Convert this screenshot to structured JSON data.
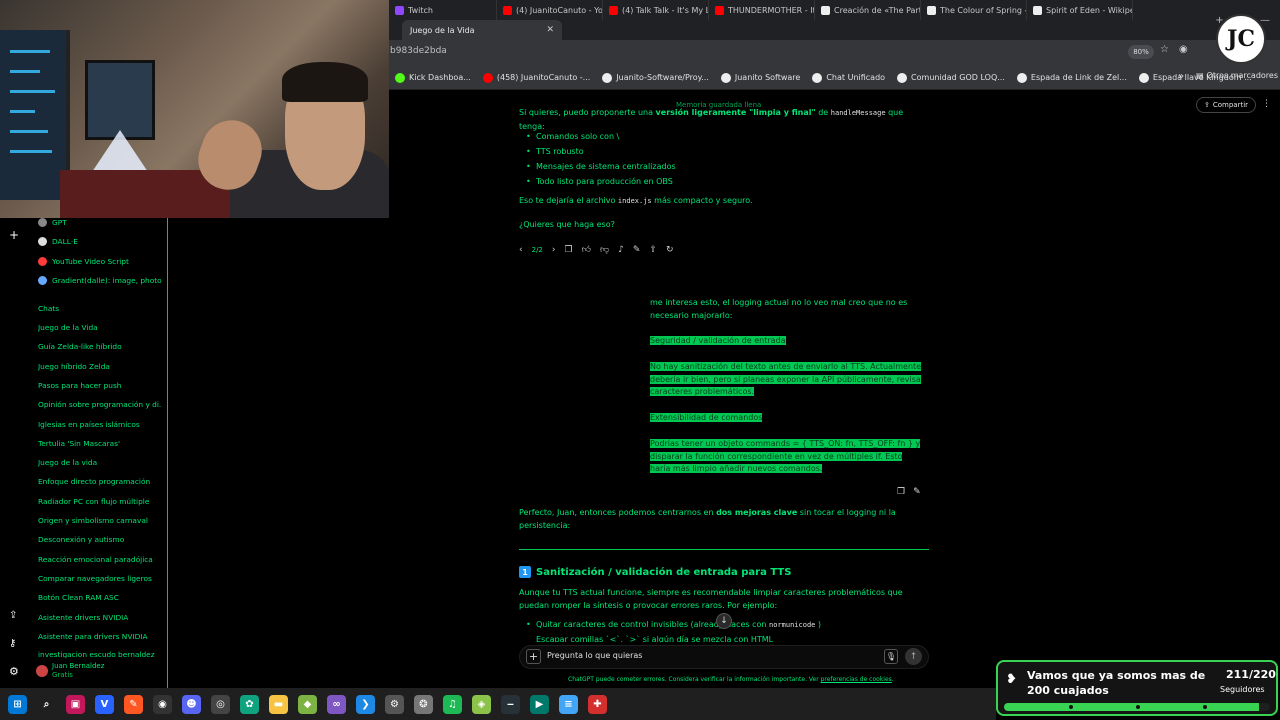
{
  "browser": {
    "tabs": [
      {
        "label": "Twitch",
        "color": "#9146ff"
      },
      {
        "label": "(4) JuanitoCanuto - Yo",
        "color": "#ff0000"
      },
      {
        "label": "(4) Talk Talk - It's My Li",
        "color": "#ff0000"
      },
      {
        "label": "THUNDERMOTHER - It",
        "color": "#ff0000"
      },
      {
        "label": "Creación de «The Party",
        "color": "#eeeeee"
      },
      {
        "label": "The Colour of Spring -",
        "color": "#eeeeee"
      },
      {
        "label": "Spirit of Eden - Wikipe",
        "color": "#eeeeee"
      }
    ],
    "active_tab": "Juego de la Vida",
    "url": "b983de2bda",
    "zoom": "80%",
    "bookmarks": [
      "Kick Dashboa...",
      "(458) JuanitoCanuto -...",
      "Juanito-Software/Proy...",
      "Juanito Software",
      "Chat Unificado",
      "Comunidad GOD LOQ...",
      "Espada de Link de Zel...",
      "Espada llave Kingdom ..."
    ],
    "other_bookmarks": "Otros marcadores"
  },
  "sidebar": {
    "gpts": [
      {
        "label": "GPT",
        "color": "#888888"
      },
      {
        "label": "DALL·E",
        "color": "#dddddd"
      },
      {
        "label": "YouTube Video Script",
        "color": "#ff3b3b"
      },
      {
        "label": "Gradient(dalle): image, photo...",
        "color": "#66aaff"
      }
    ],
    "chats_header": "Chats",
    "chats": [
      "Juego de la Vida",
      "Guía Zelda-like híbrido",
      "Juego híbrido Zelda",
      "Pasos para hacer push",
      "Opinión sobre programación y di...",
      "Iglesias en países islámicos",
      "Tertulia 'Sin Mascaras'",
      "Juego de la vida",
      "Enfoque directo programación",
      "Radiador PC con flujo múltiple",
      "Origen y simbolismo carnaval",
      "Desconexión y autismo",
      "Reacción emocional paradójica",
      "Comparar navegadores ligeros",
      "Botón Clean RAM ASC",
      "Asistente drivers NVIDIA",
      "Asistente para drivers NVIDIA",
      "investigacion escudo bernaldez"
    ],
    "user_name": "Juan Bernaldez",
    "user_plan": "Gratis"
  },
  "chat": {
    "memory_note": "Memoria guardada llena",
    "share_label": "Compartir",
    "intro_pre": "Si quieres, puedo proponerte una ",
    "intro_bold": "versión ligeramente \"limpia y final\"",
    "intro_mid": " de ",
    "intro_code": "handleMessage",
    "intro_post": " que tenga:",
    "bullets": [
      "Comandos solo con \\",
      "TTS robusto",
      "Mensajes de sistema centralizados",
      "Todo listo para producción en OBS"
    ],
    "file_pre": "Eso te dejaría el archivo ",
    "file_code": "index.js",
    "file_post": " más compacto y seguro.",
    "question": "¿Quieres que haga eso?",
    "pager": "2/2",
    "user_msg_1": "me interesa esto, el logging actual no lo veo mal creo que no es necesario majorarlo:",
    "user_hl_1": "Seguridad / validación de entrada",
    "user_hl_2": "No hay sanitización del texto antes de enviarlo al TTS. Actualmente debería ir bien, pero si planeas exponer la API públicamente, revisa caracteres problemáticos.",
    "user_hl_3": "Extensibilidad de comandos",
    "user_hl_4": "Podrías tener un objeto commands = { TTS_ON: fn, TTS_OFF: fn } y disparar la función correspondiente en vez de múltiples if. Esto haría más limpio añadir nuevos comandos.",
    "reply_pre": "Perfecto, Juan, entonces podemos centrarnos en ",
    "reply_bold": "dos mejoras clave",
    "reply_post": " sin tocar el logging ni la persistencia:",
    "heading_num": "1",
    "heading": "Sanitización / validación de entrada para TTS",
    "heading_body": "Aunque tu TTS actual funcione, siempre es recomendable limpiar caracteres problemáticos que puedan romper la síntesis o provocar errores raros. Por ejemplo:",
    "sub_bullet_1_pre": "Quitar caracteres de control invisibles (already ",
    "sub_bullet_1_mid": "haces con ",
    "sub_bullet_1_code": "normunicode",
    "sub_bullet_1_post": " )",
    "sub_bullet_2": "Escapar comillas `<`, `>` si algún día se mezcla con HTML",
    "input_placeholder": "Pregunta lo que quieras",
    "disclaimer_pre": "ChatGPT puede cometer errores. Considera verificar la información importante. Ver ",
    "disclaimer_link": "preferencias de cookies",
    "disclaimer_post": "."
  },
  "follower_goal": {
    "title": "Vamos que ya somos mas de 200 cuajados",
    "count": "211/220",
    "label": "Seguidores",
    "current": 211,
    "goal": 220
  },
  "taskbar": {
    "apps": [
      {
        "name": "windows-start",
        "glyph": "⊞",
        "color": "#0078d4"
      },
      {
        "name": "search",
        "glyph": "⌕",
        "color": "#1f1f1f"
      },
      {
        "name": "app-red",
        "glyph": "▣",
        "color": "#c2185b"
      },
      {
        "name": "vivaldi",
        "glyph": "V",
        "color": "#2962ff"
      },
      {
        "name": "app-orange",
        "glyph": "✎",
        "color": "#ff5722"
      },
      {
        "name": "obs",
        "glyph": "◉",
        "color": "#333333"
      },
      {
        "name": "discord",
        "glyph": "☻",
        "color": "#5865f2"
      },
      {
        "name": "app-circle",
        "glyph": "◎",
        "color": "#444444"
      },
      {
        "name": "chatgpt",
        "glyph": "✿",
        "color": "#10a37f"
      },
      {
        "name": "folder",
        "glyph": "▬",
        "color": "#f6c343"
      },
      {
        "name": "app-cube",
        "glyph": "◆",
        "color": "#7cb342"
      },
      {
        "name": "visual-studio",
        "glyph": "∞",
        "color": "#7e57c2"
      },
      {
        "name": "vscode",
        "glyph": "❯",
        "color": "#1e88e5"
      },
      {
        "name": "settings-hub",
        "glyph": "⚙",
        "color": "#555555"
      },
      {
        "name": "app-wheel",
        "glyph": "❂",
        "color": "#777777"
      },
      {
        "name": "spotify",
        "glyph": "♫",
        "color": "#1db954"
      },
      {
        "name": "app-diamond",
        "glyph": "◈",
        "color": "#8bc34a"
      },
      {
        "name": "app-dash",
        "glyph": "‒",
        "color": "#263238"
      },
      {
        "name": "terminal",
        "glyph": "▶",
        "color": "#00796b"
      },
      {
        "name": "notepad",
        "glyph": "≡",
        "color": "#42a5f5"
      },
      {
        "name": "pdf",
        "glyph": "✚",
        "color": "#d32f2f"
      }
    ]
  }
}
